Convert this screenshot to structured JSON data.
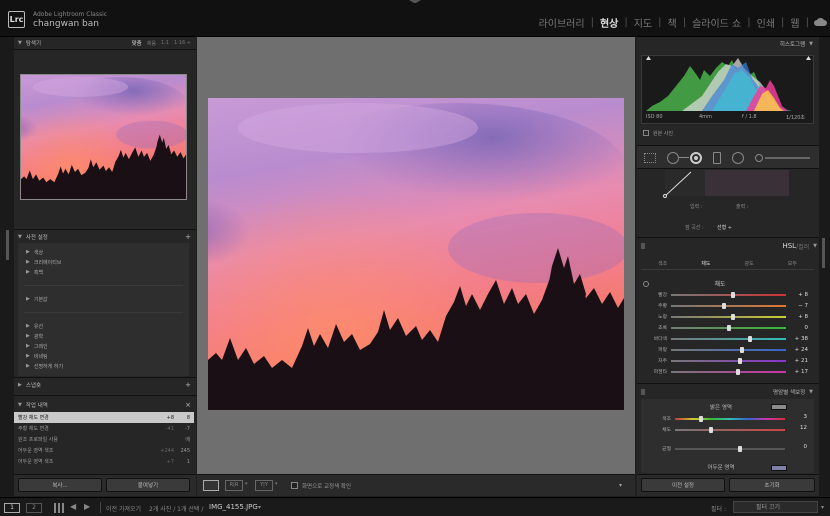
{
  "app": {
    "logo": "Lrc",
    "title": "Adobe Lightroom Classic",
    "user": "changwan ban"
  },
  "modules": [
    {
      "label": "라이브러리",
      "active": false
    },
    {
      "label": "현상",
      "active": true
    },
    {
      "label": "지도",
      "active": false
    },
    {
      "label": "책",
      "active": false
    },
    {
      "label": "슬라이드 쇼",
      "active": false
    },
    {
      "label": "인쇄",
      "active": false
    },
    {
      "label": "웹",
      "active": false
    }
  ],
  "left": {
    "navigator": {
      "title": "탐색기",
      "zoom_fit": "맞춤",
      "zoom_fill": "채움",
      "zoom_1": "1:1",
      "zoom_custom": "1:16 ÷"
    },
    "presets": {
      "title": "사전 설정",
      "groups_a": [
        "색상",
        "크리에이티브",
        "흑백"
      ],
      "groups_b": [
        "기본값"
      ],
      "groups_c": [
        "유선",
        "광학",
        "그레인",
        "비네팅",
        "선명하게 하기"
      ]
    },
    "snapshots": {
      "title": "스냅숏",
      "add": "+"
    },
    "history": {
      "title": "작업 내역",
      "close": "×",
      "rows": [
        {
          "name": "빨강 채도 변경",
          "delta": "+8",
          "value": "8",
          "selected": true
        },
        {
          "name": "주황 채도 변경",
          "delta": "-41",
          "value": "-7",
          "selected": false
        },
        {
          "name": "원조 프로파일 사용",
          "delta": "",
          "value": "에",
          "selected": false
        },
        {
          "name": "어두운 영역 색조",
          "delta": "+244",
          "value": "245",
          "selected": false
        },
        {
          "name": "어두운 영역 색조",
          "delta": "+7",
          "value": "1",
          "selected": false
        }
      ]
    },
    "copy_button": "복사...",
    "paste_button": "붙여넣기"
  },
  "toolbar": {
    "proof_label": "화면으로 교정색 확인"
  },
  "right": {
    "histogram": {
      "title": "히스토그램",
      "iso": "ISO 80",
      "focal": "4mm",
      "aperture": "f / 1.8",
      "shutter": "1/120초",
      "original_photo": "원본 사진"
    },
    "curve": {
      "input_label": "입력 :",
      "output_label": "출력 :",
      "channel_label": "점 곡선 :",
      "channel_value": "선형 ÷"
    },
    "hsl": {
      "title": "HSL",
      "title_sep": " / ",
      "title_alt": "컬러",
      "tabs": [
        "색조",
        "채도",
        "광도",
        "모두"
      ],
      "active_tab": 1,
      "section": "채도",
      "rows": [
        {
          "name": "빨강",
          "value": "+ 8",
          "pct": 0.54,
          "grad": "linear-gradient(90deg,#777,#c33)"
        },
        {
          "name": "주황",
          "value": "− 7",
          "pct": 0.46,
          "grad": "linear-gradient(90deg,#777,#d73)"
        },
        {
          "name": "노랑",
          "value": "+ 8",
          "pct": 0.54,
          "grad": "linear-gradient(90deg,#777,#cc3)"
        },
        {
          "name": "초록",
          "value": "0",
          "pct": 0.5,
          "grad": "linear-gradient(90deg,#777,#3b3)"
        },
        {
          "name": "바다색",
          "value": "+ 38",
          "pct": 0.69,
          "grad": "linear-gradient(90deg,#777,#3bb)"
        },
        {
          "name": "파랑",
          "value": "+ 24",
          "pct": 0.62,
          "grad": "linear-gradient(90deg,#777,#36c)"
        },
        {
          "name": "자주",
          "value": "+ 21",
          "pct": 0.6,
          "grad": "linear-gradient(90deg,#777,#83c)"
        },
        {
          "name": "마젠타",
          "value": "+ 17",
          "pct": 0.58,
          "grad": "linear-gradient(90deg,#777,#c3a)"
        }
      ]
    },
    "split": {
      "title": "명암별 색보정",
      "highlights": "밝은 영역",
      "hue_label": "색조",
      "hue_value": "3",
      "sat_label": "채도",
      "sat_value": "12",
      "balance_label": "균형",
      "balance_value": "0",
      "shadows": "어두운 영역"
    },
    "prev_button": "이전 설정",
    "reset_button": "초기화"
  },
  "bottom": {
    "page1": "1",
    "page2": "2",
    "prev_import": "이전 가져오기",
    "count": "2개 사진 / 1개 선택 /",
    "filename": "IMG_4155.JPG",
    "filter_label": "필터 :",
    "filter_value": "필터 끄기"
  },
  "colors": {
    "accent": "#e8e8e8",
    "active_module": "#dddddd",
    "selected_row": "#c9c9c9"
  }
}
